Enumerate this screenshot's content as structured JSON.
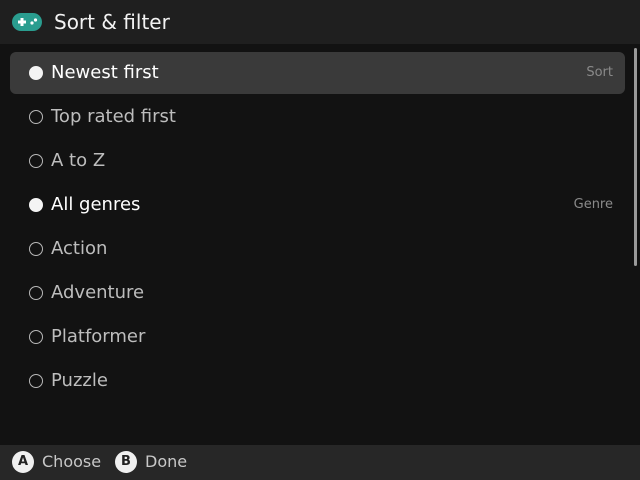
{
  "header": {
    "title": "Sort & filter",
    "icon": "gamepad-icon",
    "icon_color": "#2a9d8f"
  },
  "rows": [
    {
      "label": "Newest first",
      "selected": true,
      "focused": true,
      "section_tag": "Sort"
    },
    {
      "label": "Top rated first",
      "selected": false,
      "focused": false,
      "section_tag": ""
    },
    {
      "label": "A to Z",
      "selected": false,
      "focused": false,
      "section_tag": ""
    },
    {
      "label": "All genres",
      "selected": true,
      "focused": false,
      "section_tag": "Genre"
    },
    {
      "label": "Action",
      "selected": false,
      "focused": false,
      "section_tag": ""
    },
    {
      "label": "Adventure",
      "selected": false,
      "focused": false,
      "section_tag": ""
    },
    {
      "label": "Platformer",
      "selected": false,
      "focused": false,
      "section_tag": ""
    },
    {
      "label": "Puzzle",
      "selected": false,
      "focused": false,
      "section_tag": ""
    }
  ],
  "footer": {
    "hints": [
      {
        "button": "A",
        "label": "Choose"
      },
      {
        "button": "B",
        "label": "Done"
      }
    ]
  },
  "colors": {
    "background": "#121212",
    "header": "#1f1f1f",
    "focused_row": "#3a3a3a",
    "footer": "#272727"
  }
}
